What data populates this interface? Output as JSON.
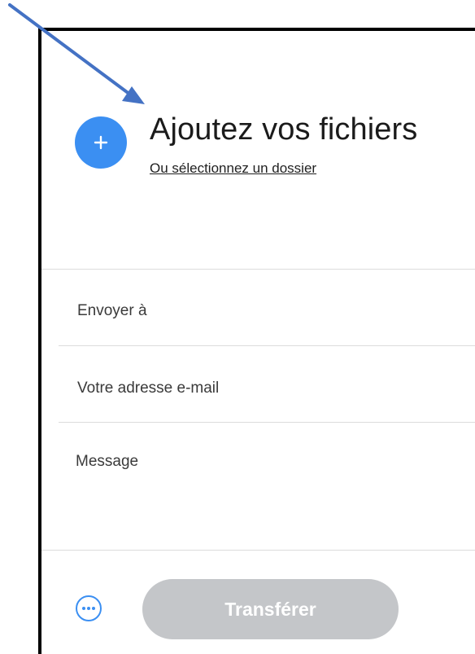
{
  "upload": {
    "add_title": "Ajoutez vos fichiers",
    "folder_link": "Ou sélectionnez un dossier"
  },
  "form": {
    "to_placeholder": "Envoyer à",
    "email_placeholder": "Votre adresse e-mail",
    "message_placeholder": "Message"
  },
  "actions": {
    "transfer_label": "Transférer"
  },
  "icons": {
    "add": "plus-icon",
    "options": "more-options-icon",
    "annotation": "annotation-arrow"
  },
  "colors": {
    "accent": "#3b8ff2",
    "button_disabled": "#c4c6c9",
    "annotation_arrow": "#4472c4",
    "panel_border": "#000000",
    "separator": "#dcdcdc"
  }
}
